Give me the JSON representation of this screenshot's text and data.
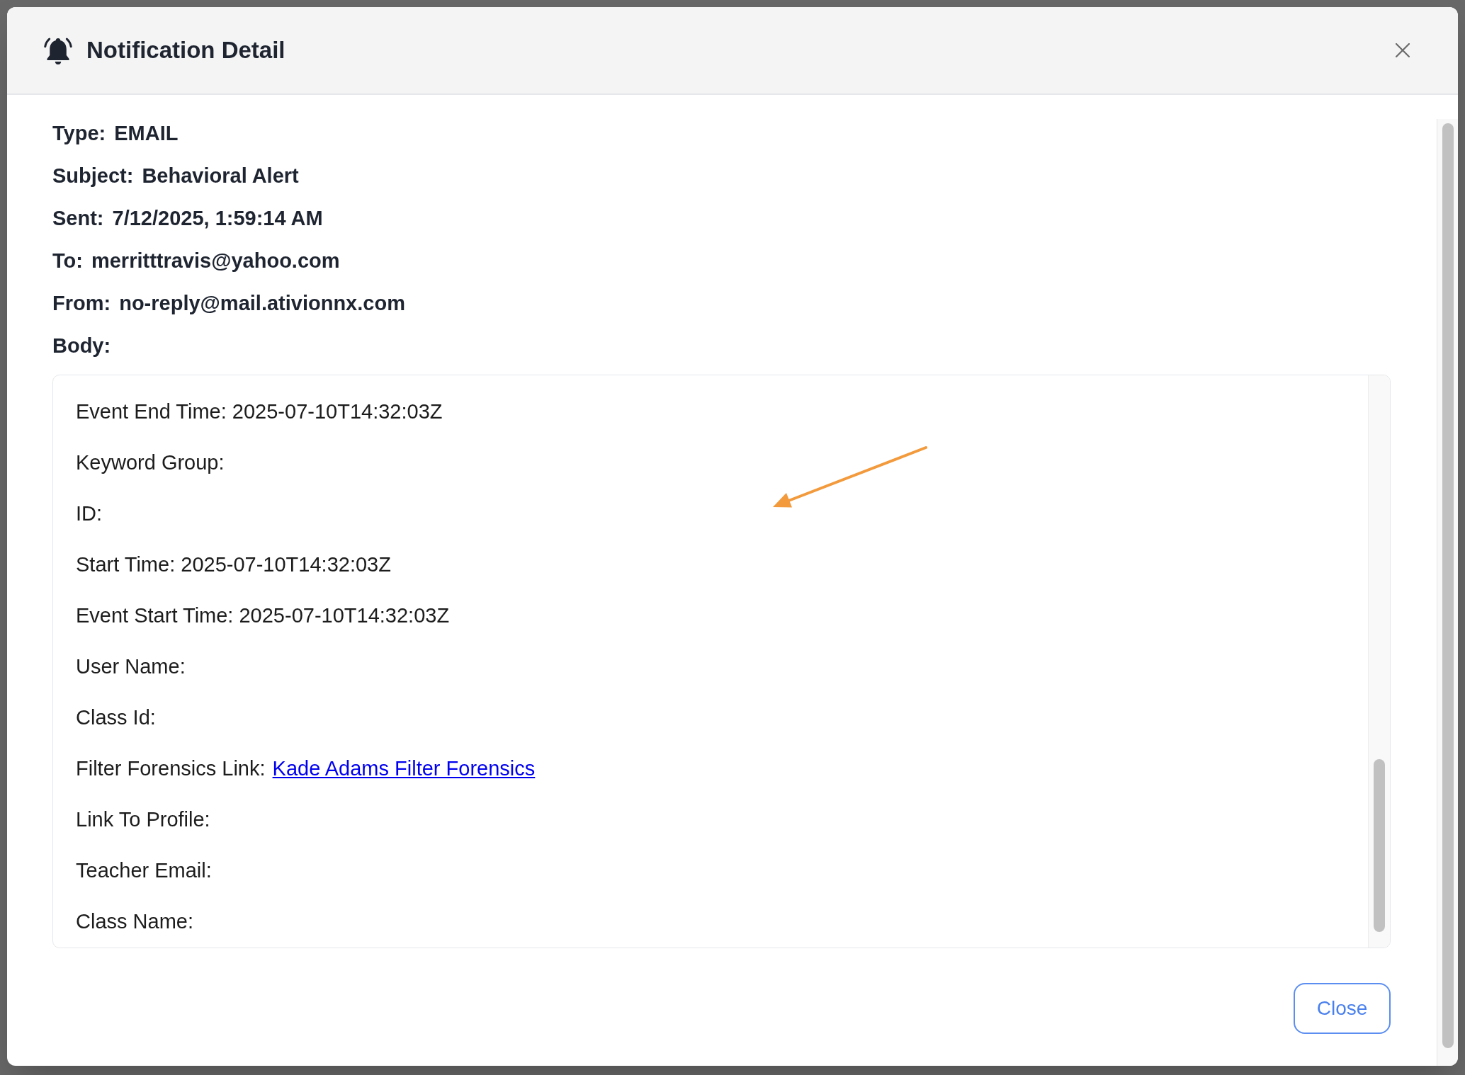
{
  "dialog": {
    "title": "Notification Detail",
    "fields": [
      {
        "label": "Type:",
        "value": "EMAIL"
      },
      {
        "label": "Subject:",
        "value": "Behavioral Alert"
      },
      {
        "label": "Sent:",
        "value": "7/12/2025, 1:59:14 AM"
      },
      {
        "label": "To:",
        "value": "merritttravis@yahoo.com"
      },
      {
        "label": "From:",
        "value": "no-reply@mail.ativionnx.com"
      }
    ],
    "body": {
      "label": "Body:",
      "lines": [
        {
          "text": "Event End Time: 2025-07-10T14:32:03Z"
        },
        {
          "text": "Keyword Group:"
        },
        {
          "text": "ID:"
        },
        {
          "text": "Start Time: 2025-07-10T14:32:03Z"
        },
        {
          "text": "Event Start Time: 2025-07-10T14:32:03Z"
        },
        {
          "text": "User Name:"
        },
        {
          "text": "Class Id:"
        },
        {
          "text": "Filter Forensics Link:",
          "link": "Kade Adams Filter Forensics"
        },
        {
          "text": "Link To Profile:"
        },
        {
          "text": "Teacher Email:"
        },
        {
          "text": "Class Name:"
        }
      ]
    },
    "buttons": [
      {
        "label": "Close"
      }
    ]
  }
}
